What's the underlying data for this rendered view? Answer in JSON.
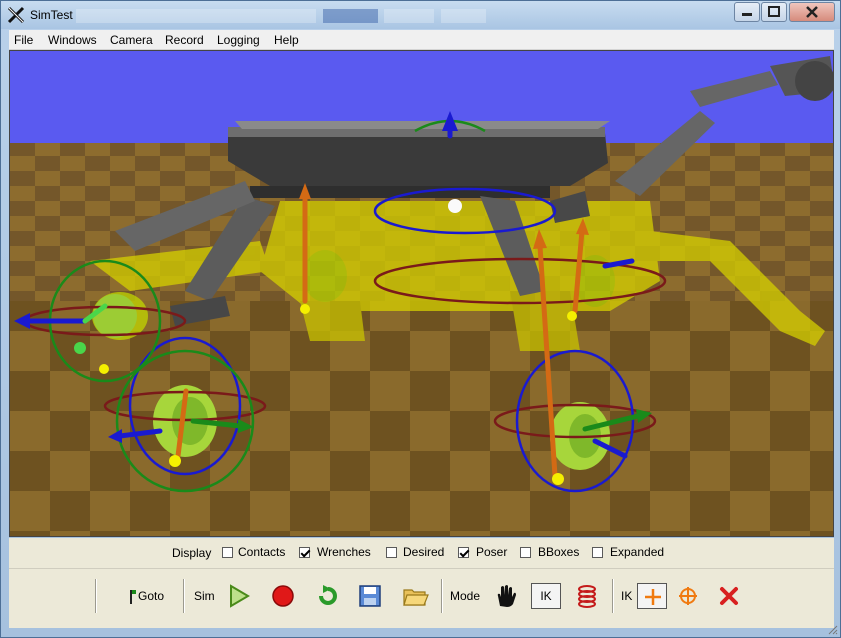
{
  "window": {
    "title": "SimTest",
    "accent": "#b9d1ea",
    "controls": {
      "minimize_icon": "minimize-icon",
      "maximize_icon": "maximize-icon",
      "close_icon": "close-icon"
    }
  },
  "menu": {
    "items": [
      {
        "label": "File"
      },
      {
        "label": "Windows"
      },
      {
        "label": "Camera"
      },
      {
        "label": "Record"
      },
      {
        "label": "Logging"
      },
      {
        "label": "Help"
      }
    ]
  },
  "viewport": {
    "sky_color": "#5a5af0",
    "floor_colors": [
      "#8a6a2c",
      "#6e5220"
    ],
    "robot_color": "#555555",
    "ghost_color": "#d6d000"
  },
  "display": {
    "label": "Display",
    "options": [
      {
        "label": "Contacts",
        "checked": false
      },
      {
        "label": "Wrenches",
        "checked": true
      },
      {
        "label": "Desired",
        "checked": false
      },
      {
        "label": "Poser",
        "checked": true
      },
      {
        "label": "BBoxes",
        "checked": false
      },
      {
        "label": "Expanded",
        "checked": false
      }
    ]
  },
  "toolbar": {
    "goto_label": "Goto",
    "sim_label": "Sim",
    "mode_label": "Mode",
    "ik_button_label": "IK",
    "ik_label": "IK",
    "icons": [
      "flag-icon",
      "play-icon",
      "record-icon",
      "reset-icon",
      "save-icon",
      "open-folder-icon",
      "hand-icon",
      "spring-icon",
      "plus-icon",
      "crosshair-icon",
      "delete-icon"
    ]
  }
}
